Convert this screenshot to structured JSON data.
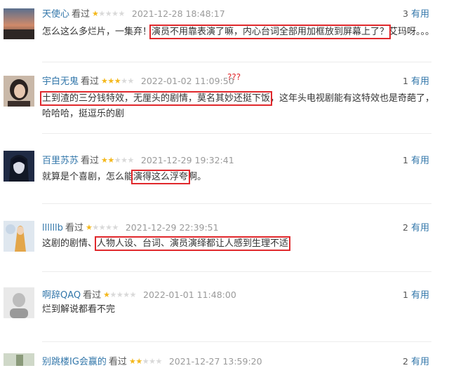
{
  "comments": [
    {
      "user": "天使心",
      "status": "看过",
      "rating": 1,
      "time": "2021-12-28 18:48:17",
      "votes": "3",
      "useful_label": "有用",
      "text_before": "怎么这么多烂片，一集弃！",
      "text_highlight": "演员不用靠表演了嘛，内心台词全部用加框放到屏幕上了？",
      "text_after": "艾玛呀。。。"
    },
    {
      "user": "宇白无鬼",
      "status": "看过",
      "rating": 3,
      "time": "2022-01-02 11:09:50",
      "votes": "1",
      "useful_label": "有用",
      "text_before": "",
      "text_highlight": "土到渣的三分钱特效，无厘头的剧情，莫名其妙还挺下饭",
      "text_after": "，这年头电视剧能有这特效也是奇葩了，哈哈哈，挺逗乐的剧"
    },
    {
      "user": "百里苏苏",
      "status": "看过",
      "rating": 2,
      "time": "2021-12-29 19:32:41",
      "votes": "1",
      "useful_label": "有用",
      "text_before": "就算是个喜剧，怎么能",
      "text_highlight": "演得这么浮夸",
      "text_after": "啊。"
    },
    {
      "user": "llllllb",
      "status": "看过",
      "rating": 1,
      "time": "2021-12-29 22:39:51",
      "votes": "2",
      "useful_label": "有用",
      "text_before": "这剧的剧情、",
      "text_highlight": "人物人设、台词、演员演绎都让人感到生理不适",
      "text_after": ""
    },
    {
      "user": "啊辞QAQ",
      "status": "看过",
      "rating": 1,
      "time": "2022-01-01 11:48:00",
      "votes": "1",
      "useful_label": "有用",
      "text_before": "烂到解说都看不完",
      "text_highlight": "",
      "text_after": ""
    },
    {
      "user": "别跳楼IG会赢的",
      "status": "看过",
      "rating": 2,
      "time": "2021-12-27 13:59:20",
      "votes": "2",
      "useful_label": "有用",
      "text_before": "",
      "text_highlight": "",
      "text_after": ""
    }
  ],
  "annotation": "???",
  "colors": {
    "link": "#3377aa",
    "star_on": "#f4b81c",
    "star_off": "#d9d9d9",
    "highlight_box": "#e0282c"
  }
}
